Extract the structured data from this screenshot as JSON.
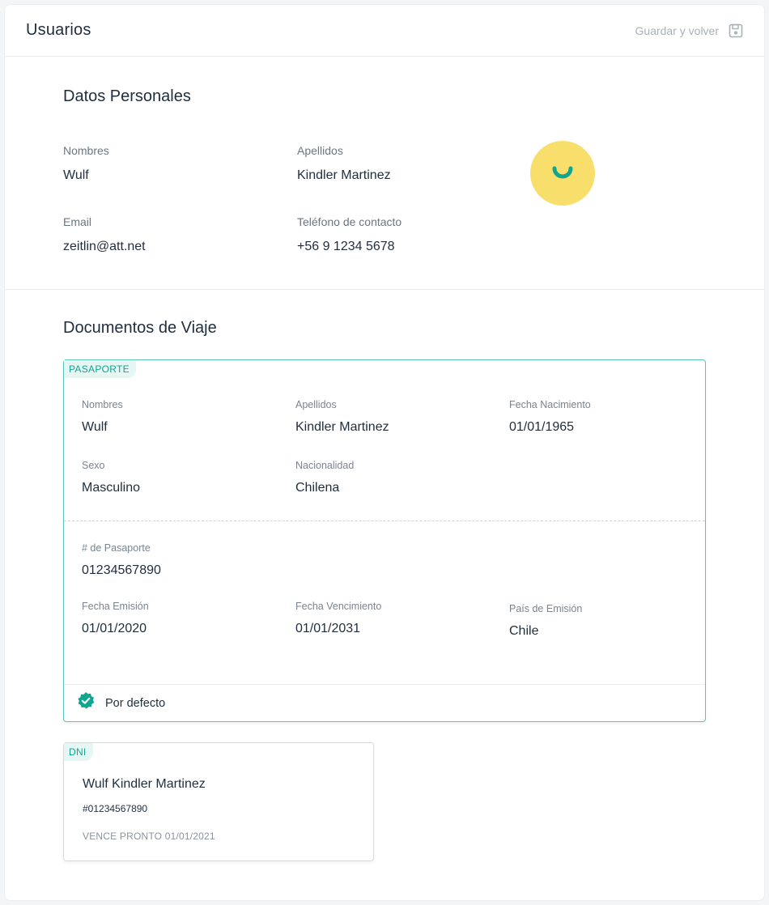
{
  "header": {
    "title": "Usuarios",
    "save_label": "Guardar y volver"
  },
  "personal": {
    "title": "Datos Personales",
    "fields": {
      "nombres_label": "Nombres",
      "nombres_value": "Wulf",
      "apellidos_label": "Apellidos",
      "apellidos_value": "Kindler Martinez",
      "email_label": "Email",
      "email_value": "zeitlin@att.net",
      "telefono_label": "Teléfono de contacto",
      "telefono_value": "+56 9 1234 5678"
    },
    "avatar_color": "#f8df6c",
    "avatar_accent": "#11a58f"
  },
  "documents": {
    "title": "Documentos de Viaje",
    "passport": {
      "tag": "PASAPORTE",
      "nombres_label": "Nombres",
      "nombres_value": "Wulf",
      "apellidos_label": "Apellidos",
      "apellidos_value": "Kindler Martinez",
      "nacimiento_label": "Fecha Nacimiento",
      "nacimiento_value": "01/01/1965",
      "sexo_label": "Sexo",
      "sexo_value": "Masculino",
      "nacionalidad_label": "Nacionalidad",
      "nacionalidad_value": "Chilena",
      "numero_label": "# de Pasaporte",
      "numero_value": "01234567890",
      "emision_label": "Fecha Emisión",
      "emision_value": "01/01/2020",
      "vencimiento_label": "Fecha Vencimiento",
      "vencimiento_value": "01/01/2031",
      "pais_label": "País de Emisión",
      "pais_value": "Chile",
      "default_label": "Por defecto",
      "accent_color": "#11a58f"
    },
    "dni": {
      "tag": "DNI",
      "name": "Wulf Kindler Martinez",
      "number": "#01234567890",
      "expiry": "VENCE PRONTO 01/01/2021"
    }
  }
}
